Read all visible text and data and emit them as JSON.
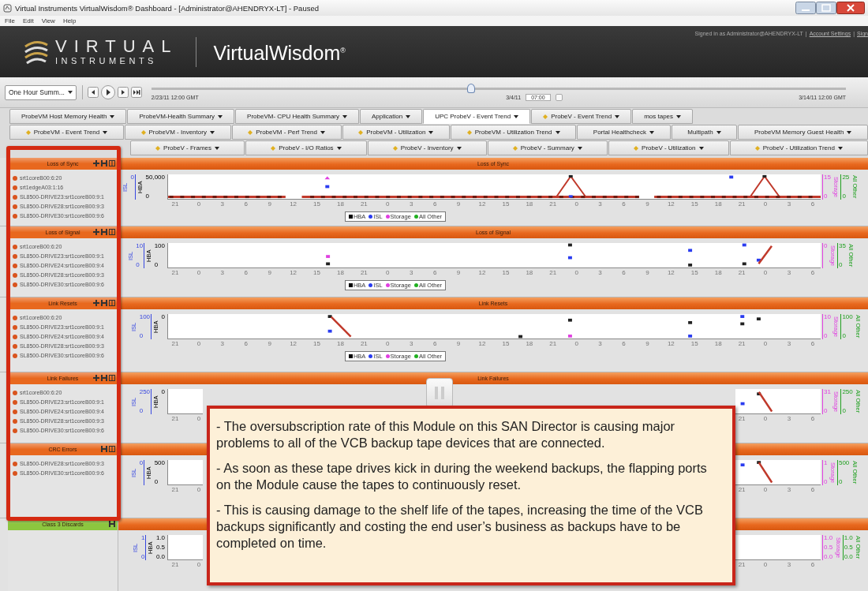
{
  "window": {
    "title": "Virtual Instruments VirtualWisdom® Dashboard - [Administrator@AHENDRYX-LT] - Paused"
  },
  "menu": [
    "File",
    "Edit",
    "View",
    "Help"
  ],
  "header": {
    "brand_top": "VIRTUAL",
    "brand_bottom": "INSTRUMENTS",
    "product": "VirtualWisdom$^{®}$",
    "signed_in": "Signed in as Administrator@AHENDRYX-LT",
    "separator": "|",
    "links": [
      "Account Settings",
      "Sign"
    ]
  },
  "timebar": {
    "summary": "One Hour Summ...",
    "start": "2/23/11 12:00 GMT",
    "current_date": "3/4/11",
    "current_time": "07:00",
    "end": "3/14/11 12:00 GMT",
    "level": 0.46
  },
  "tab_rows": [
    [
      {
        "label": "ProbeVM Host Memory Health",
        "icon": false,
        "selected": false
      },
      {
        "label": "ProbeVM-Health Summary",
        "icon": false,
        "selected": false
      },
      {
        "label": "ProbeVM- CPU Health Summary",
        "icon": false,
        "selected": false
      },
      {
        "label": "Application",
        "icon": false,
        "selected": false
      },
      {
        "label": "UPC ProbeV - Event Trend",
        "icon": false,
        "selected": true
      },
      {
        "label": "ProbeV - Event Trend",
        "icon": true,
        "selected": false
      },
      {
        "label": "mos tapes",
        "icon": false,
        "selected": false
      }
    ],
    [
      {
        "label": "ProbeVM - Event Trend",
        "icon": true,
        "selected": false
      },
      {
        "label": "ProbeVM - Inventory",
        "icon": true,
        "selected": false
      },
      {
        "label": "ProbeVM - Perf Trend",
        "icon": true,
        "selected": false
      },
      {
        "label": "ProbeVM - Utilization",
        "icon": true,
        "selected": false
      },
      {
        "label": "ProbeVM - Utilization Trend",
        "icon": true,
        "selected": false
      },
      {
        "label": "Portal Healthcheck",
        "icon": false,
        "selected": false
      },
      {
        "label": "Multipath",
        "icon": false,
        "selected": false
      },
      {
        "label": "ProbeVM Memory Guest Health",
        "icon": false,
        "selected": false
      }
    ],
    [
      {
        "label": "ProbeV - Frames",
        "icon": true,
        "selected": false
      },
      {
        "label": "ProbeV - I/O Ratios",
        "icon": true,
        "selected": false
      },
      {
        "label": "ProbeV - Inventory",
        "icon": true,
        "selected": false
      },
      {
        "label": "ProbeV - Summary",
        "icon": true,
        "selected": false
      },
      {
        "label": "ProbeV - Utilization",
        "icon": true,
        "selected": false
      },
      {
        "label": "ProbeV - Utilization Trend",
        "icon": true,
        "selected": false
      }
    ]
  ],
  "panels": [
    {
      "title": "Loss of Sync",
      "chart_title": "Loss of Sync",
      "color": "#e8681e",
      "add_tool": true,
      "columns_tool": true,
      "items": [
        "srt1coreB00:6:20",
        "srt1edgeA03:1:16",
        "SL8500-DRIVE23:srt1coreB00:9:1",
        "SL8500-DRIVE28:srt1coreB00:9:3",
        "SL8500-DRIVE30:srt1coreB00:9:6"
      ],
      "axes": {
        "isl": {
          "label": "ISL",
          "ticks": [
            "0"
          ]
        },
        "hba": {
          "label": "HBA",
          "ticks": [
            "50,000",
            "0"
          ]
        },
        "storage": {
          "label": "Storage",
          "ticks": [
            "15",
            "0"
          ]
        },
        "other": {
          "label": "All Other",
          "ticks": [
            "25",
            "0"
          ]
        }
      },
      "x_ticks": [
        "21",
        "0",
        "3",
        "6",
        "9",
        "12",
        "15",
        "18",
        "21",
        "0",
        "3",
        "6",
        "9",
        "12",
        "15",
        "18",
        "21",
        "0",
        "3",
        "6",
        "9",
        "12",
        "15",
        "18",
        "21",
        "0",
        "3",
        "6"
      ],
      "legend": [
        {
          "label": "HBA",
          "color": "#000000"
        },
        {
          "label": "ISL",
          "color": "#2a3cf0"
        },
        {
          "label": "Storage",
          "color": "#e040e0"
        },
        {
          "label": "All Other",
          "color": "#20b020"
        }
      ]
    },
    {
      "title": "Loss of Signal",
      "chart_title": "Loss of Signal",
      "color": "#e8681e",
      "add_tool": true,
      "columns_tool": true,
      "items": [
        "srt1coreB00:6:20",
        "SL8500-DRIVE23:srt1coreB00:9:1",
        "SL8500-DRIVE24:srt1coreB00:9:4",
        "SL8500-DRIVE28:srt1coreB00:9:3",
        "SL8500-DRIVE30:srt1coreB00:9:6"
      ],
      "axes": {
        "isl": {
          "label": "ISL",
          "ticks": [
            "10",
            "0"
          ]
        },
        "hba": {
          "label": "HBA",
          "ticks": [
            "100",
            "0"
          ]
        },
        "storage": {
          "label": "Storage",
          "ticks": [
            "0"
          ]
        },
        "other": {
          "label": "All Other",
          "ticks": [
            "35",
            "0"
          ]
        }
      },
      "x_ticks": [
        "21",
        "0",
        "3",
        "6",
        "9",
        "12",
        "15",
        "18",
        "21",
        "0",
        "3",
        "6",
        "9",
        "12",
        "15",
        "18",
        "21",
        "0",
        "3",
        "6",
        "9",
        "12",
        "15",
        "18",
        "21",
        "0",
        "3",
        "6"
      ],
      "legend": [
        {
          "label": "HBA",
          "color": "#000000"
        },
        {
          "label": "ISL",
          "color": "#2a3cf0"
        },
        {
          "label": "Storage",
          "color": "#e040e0"
        },
        {
          "label": "All Other",
          "color": "#20b020"
        }
      ]
    },
    {
      "title": "Link Resets",
      "chart_title": "Link Resets",
      "color": "#e8681e",
      "add_tool": true,
      "columns_tool": true,
      "items": [
        "srt1coreB00:6:20",
        "SL8500-DRIVE23:srt1coreB00:9:1",
        "SL8500-DRIVE24:srt1coreB00:9:4",
        "SL8500-DRIVE28:srt1coreB00:9:3",
        "SL8500-DRIVE30:srt1coreB00:9:6"
      ],
      "axes": {
        "isl": {
          "label": "ISL",
          "ticks": [
            "100",
            "0"
          ]
        },
        "hba": {
          "label": "HBA",
          "ticks": [
            "0"
          ]
        },
        "storage": {
          "label": "Storage",
          "ticks": [
            "10",
            "0"
          ]
        },
        "other": {
          "label": "All Other",
          "ticks": [
            "100",
            "0"
          ]
        }
      },
      "x_ticks": [
        "21",
        "0",
        "3",
        "6",
        "9",
        "12",
        "15",
        "18",
        "21",
        "0",
        "3",
        "6",
        "9",
        "12",
        "15",
        "18",
        "21",
        "0",
        "3",
        "6",
        "9",
        "12",
        "15",
        "18",
        "21",
        "0",
        "3",
        "6"
      ],
      "legend": [
        {
          "label": "HBA",
          "color": "#000000"
        },
        {
          "label": "ISL",
          "color": "#2a3cf0"
        },
        {
          "label": "Storage",
          "color": "#e040e0"
        },
        {
          "label": "All Other",
          "color": "#20b020"
        }
      ]
    },
    {
      "title": "Link Failures",
      "chart_title": "Link Failures",
      "color": "#e8681e",
      "add_tool": true,
      "columns_tool": true,
      "items": [
        "srt1coreB00:6:20",
        "SL8500-DRIVE23:srt1coreB00:9:1",
        "SL8500-DRIVE24:srt1coreB00:9:4",
        "SL8500-DRIVE28:srt1coreB00:9:3",
        "SL8500-DRIVE30:srt1coreB00:9:6"
      ],
      "axes": {
        "isl": {
          "label": "ISL",
          "ticks": [
            "250",
            "0"
          ]
        },
        "hba": {
          "label": "HBA",
          "ticks": [
            "0"
          ]
        },
        "storage": {
          "label": "Storage",
          "ticks": [
            "31",
            "0"
          ]
        },
        "other": {
          "label": "All Other",
          "ticks": [
            "250",
            "0"
          ]
        }
      },
      "x_ticks_start": [
        "21",
        "0"
      ],
      "x_ticks_end": [
        "21",
        "0",
        "3",
        "6"
      ]
    },
    {
      "title": "CRC Errors",
      "color": "#e8681e",
      "add_tool": false,
      "columns_tool": true,
      "items": [
        "SL8500-DRIVE28:srt1coreB00:9:3",
        "SL8500-DRIVE30:srt1coreB00:9:6"
      ],
      "axes": {
        "isl": {
          "label": "ISL",
          "ticks": [
            "0"
          ]
        },
        "hba": {
          "label": "HBA",
          "ticks": [
            "500",
            "0"
          ]
        },
        "storage": {
          "label": "Storage",
          "ticks": [
            "1",
            "0"
          ]
        },
        "other": {
          "label": "All Other",
          "ticks": [
            "500",
            "0"
          ]
        }
      },
      "x_ticks_start": [
        "21",
        "0"
      ],
      "x_ticks_end": [
        "21",
        "0",
        "3",
        "6"
      ]
    },
    {
      "title": "Class 3 Discards",
      "color": "#8cc63f",
      "add_tool": false,
      "columns_tool": false,
      "axes": {
        "isl": {
          "label": "ISL",
          "ticks": [
            "1",
            "0"
          ]
        },
        "hba": {
          "label": "HBA",
          "ticks": [
            "1.0",
            "0.5",
            "0.0"
          ]
        },
        "storage": {
          "label": "Storage",
          "ticks": [
            "1.0",
            "0.5",
            "0.0"
          ]
        },
        "other": {
          "label": "All Other",
          "ticks": [
            "1.0",
            "0.5",
            "0.0"
          ]
        }
      },
      "x_ticks_start": [
        "21",
        "0"
      ],
      "x_ticks_end": [
        "21",
        "0",
        "3",
        "6"
      ]
    }
  ],
  "callout": {
    "paragraphs": [
      "- The oversubscription rate of this Module on this SAN Director is causing major problems to all of the VCB backup tape devices that are connected.",
      "- As soon as these tape drives kick in during the weekend backups, the flapping ports on the Module cause the tapes to continuously reset.",
      "- This is causing damage to the shelf life of the tapes, increasing the time of the VCB backups significantly and costing the end user’s business as backups have to be completed on time."
    ]
  }
}
